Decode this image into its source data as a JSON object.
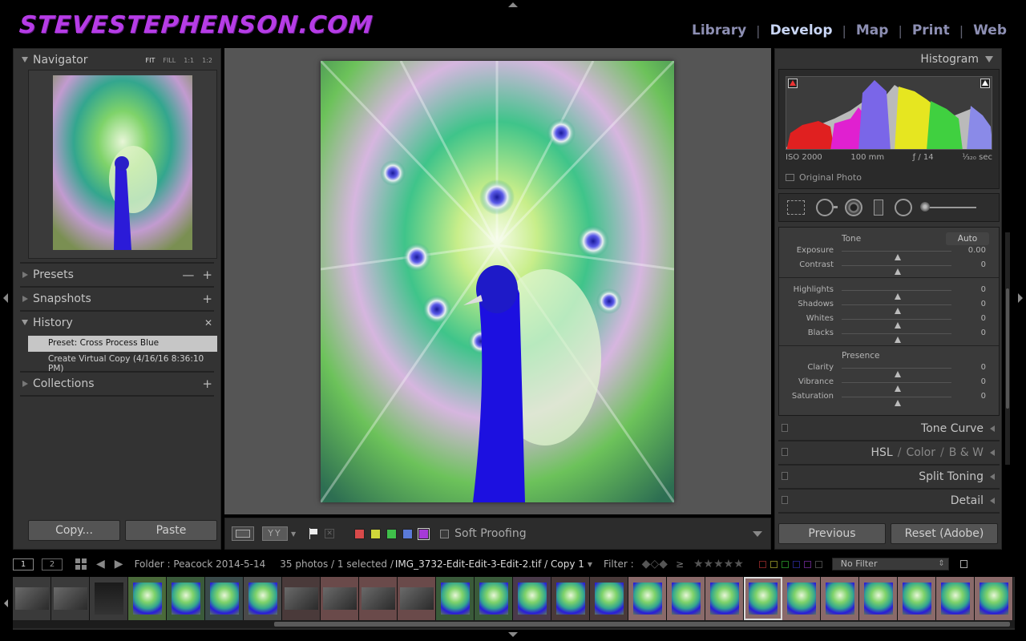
{
  "header": {
    "logo": "STEVESTEPHENSON.COM",
    "modules": [
      {
        "label": "Library",
        "active": false
      },
      {
        "label": "Develop",
        "active": true
      },
      {
        "label": "Map",
        "active": false
      },
      {
        "label": "Print",
        "active": false
      },
      {
        "label": "Web",
        "active": false
      }
    ],
    "separator": "|"
  },
  "left": {
    "navigator": {
      "title": "Navigator",
      "options": [
        "FIT",
        "FILL",
        "1:1",
        "1:2"
      ]
    },
    "presets": {
      "title": "Presets",
      "minus": "—",
      "plus": "+"
    },
    "snapshots": {
      "title": "Snapshots",
      "plus": "+"
    },
    "history": {
      "title": "History",
      "clear": "✕",
      "items": [
        "Preset: Cross Process Blue",
        "Create Virtual Copy (4/16/16 8:36:10 PM)"
      ]
    },
    "collections": {
      "title": "Collections",
      "plus": "+"
    },
    "copy_label": "Copy...",
    "paste_label": "Paste"
  },
  "toolbar": {
    "yy_label": "YY",
    "reject": "✕",
    "colors": [
      "#d84a4a",
      "#cfd63a",
      "#3fbf4a",
      "#5a7ad8",
      "#a63ad8"
    ],
    "soft_proofing": "Soft Proofing"
  },
  "right": {
    "histogram": {
      "title": "Histogram",
      "iso": "ISO 2000",
      "focal": "100 mm",
      "aperture": "ƒ / 14",
      "shutter": "¹⁄₃₂₀ sec",
      "original_photo": "Original Photo"
    },
    "basic": {
      "tone_label": "Tone",
      "auto_label": "Auto",
      "tone_sliders": [
        {
          "label": "Exposure",
          "value": "0.00"
        },
        {
          "label": "Contrast",
          "value": "0"
        }
      ],
      "tone_sliders2": [
        {
          "label": "Highlights",
          "value": "0"
        },
        {
          "label": "Shadows",
          "value": "0"
        },
        {
          "label": "Whites",
          "value": "0"
        },
        {
          "label": "Blacks",
          "value": "0"
        }
      ],
      "presence_label": "Presence",
      "presence_sliders": [
        {
          "label": "Clarity",
          "value": "0"
        },
        {
          "label": "Vibrance",
          "value": "0"
        },
        {
          "label": "Saturation",
          "value": "0"
        }
      ]
    },
    "tone_curve": "Tone Curve",
    "hsl": {
      "hsl": "HSL",
      "color": "Color",
      "bw": "B & W",
      "sep": "/"
    },
    "split_toning": "Split Toning",
    "detail": "Detail",
    "previous_label": "Previous",
    "reset_label": "Reset (Adobe)"
  },
  "filmstrip_bar": {
    "view1": "1",
    "view2": "2",
    "folder": "Folder : Peacock 2014-5-14",
    "count": "35 photos / 1 selected /",
    "filename": "IMG_3732-Edit-Edit-3-Edit-2.tif / Copy 1",
    "filter_label": "Filter :",
    "ge": "≥",
    "stars": "★★★★★",
    "no_filter": "No Filter"
  }
}
